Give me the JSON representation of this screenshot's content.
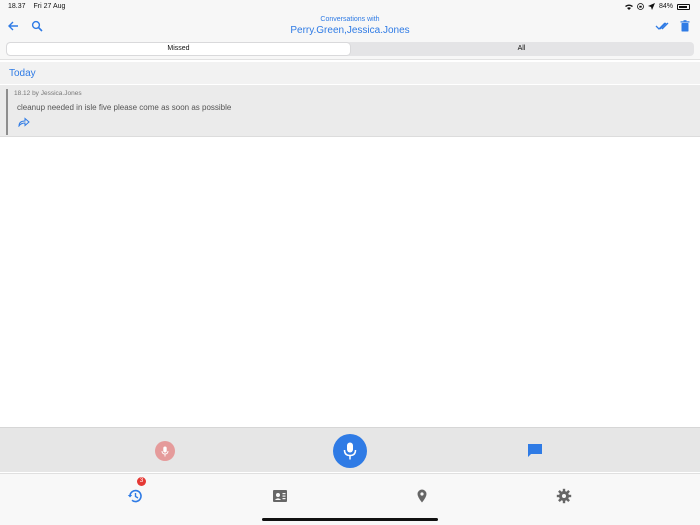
{
  "statusbar": {
    "time": "18.37",
    "date": "Fri 27 Aug",
    "battery": "84%"
  },
  "header": {
    "subtitle": "Conversations with",
    "title": "Perry.Green,Jessica.Jones"
  },
  "tabs": [
    {
      "label": "Missed",
      "active": true
    },
    {
      "label": "All",
      "active": false
    }
  ],
  "section": {
    "label": "Today"
  },
  "messages": [
    {
      "meta": "18.12 by Jessica.Jones",
      "text": "cleanup needed in isle five please come as soon as possible"
    }
  ],
  "bottom_nav": {
    "history_badge": "3",
    "items": [
      "history-icon",
      "contacts-icon",
      "location-icon",
      "settings-icon"
    ]
  },
  "colors": {
    "accent": "#2f7be5",
    "mic_disabled": "#e59b9b",
    "badge": "#e53935"
  }
}
